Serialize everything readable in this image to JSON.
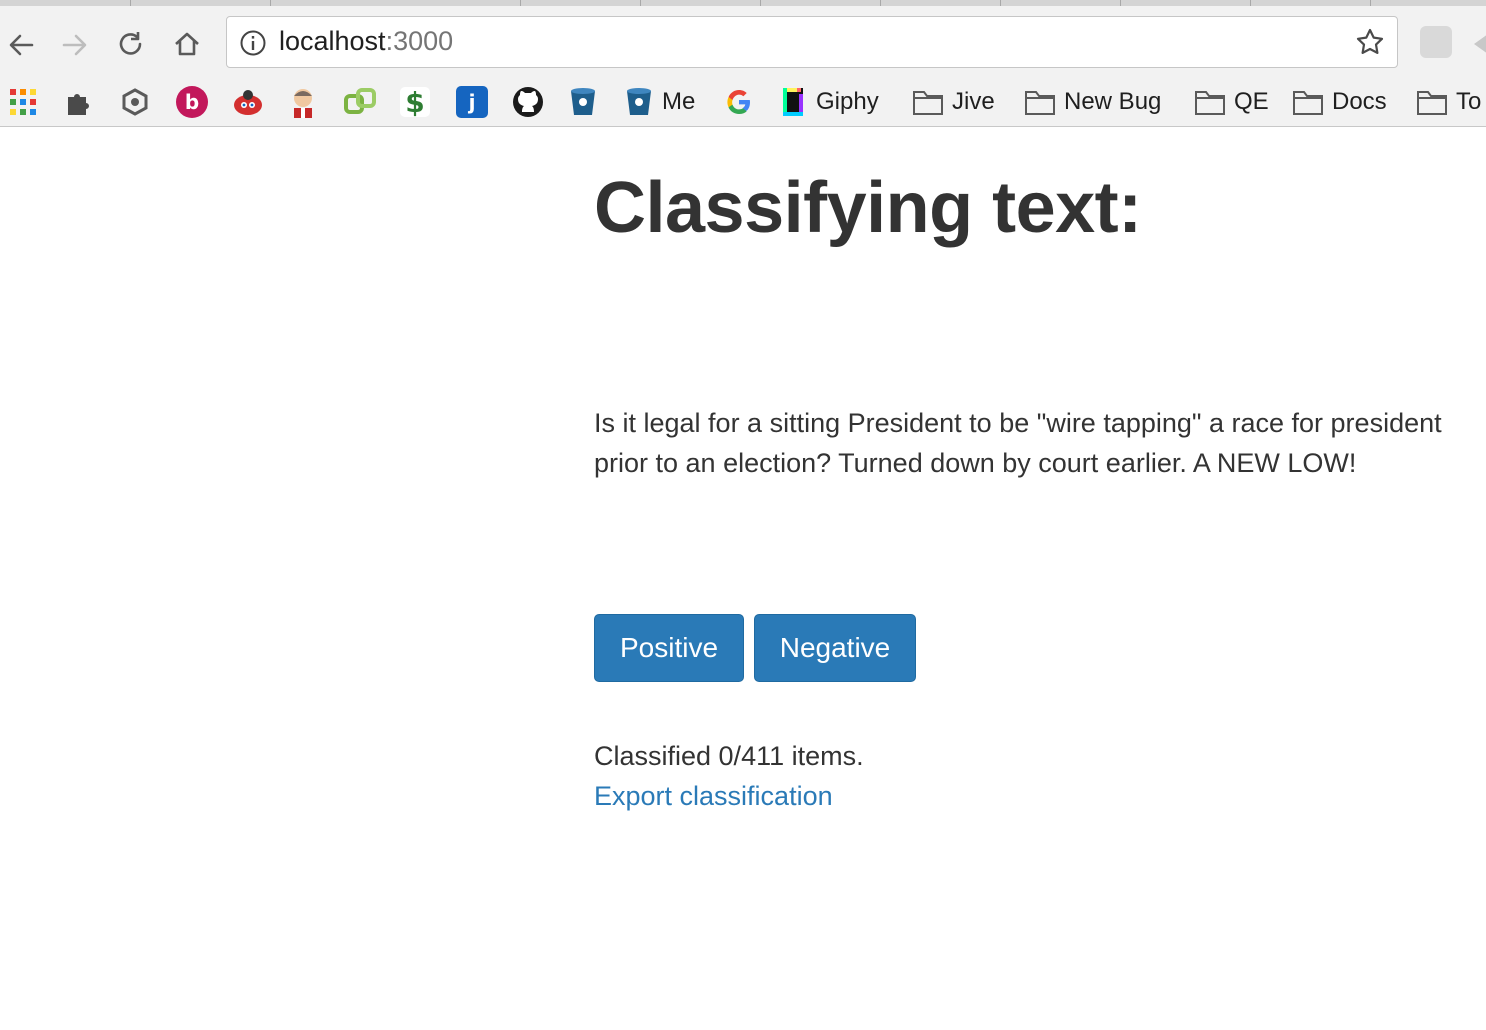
{
  "browser": {
    "url_host": "localhost",
    "url_port": ":3000",
    "bookmarks": [
      {
        "label": "",
        "icon": "apps-grid-icon"
      },
      {
        "label": "",
        "icon": "puzzle-icon"
      },
      {
        "label": "",
        "icon": "chrome-ext-icon"
      },
      {
        "label": "b",
        "icon": "b-badge-icon",
        "color": "#c2185b"
      },
      {
        "label": "",
        "icon": "ladybug-icon",
        "color": "#d32f2f"
      },
      {
        "label": "",
        "icon": "jenkins-icon"
      },
      {
        "label": "",
        "icon": "link-icon",
        "color": "#7cb342"
      },
      {
        "label": "$",
        "icon": "dollar-icon",
        "color": "#2e7d32"
      },
      {
        "label": "j",
        "icon": "j-badge-icon",
        "color": "#1565c0"
      },
      {
        "label": "",
        "icon": "github-icon"
      },
      {
        "label": "",
        "icon": "bucket-icon",
        "color": "#1e5e8c"
      },
      {
        "label": "Me",
        "icon": "bucket-icon",
        "color": "#1e5e8c"
      },
      {
        "label": "",
        "icon": "google-icon"
      },
      {
        "label": "Giphy",
        "icon": "giphy-icon"
      },
      {
        "label": "Jive",
        "icon": "folder-icon"
      },
      {
        "label": "New Bug",
        "icon": "folder-icon"
      },
      {
        "label": "QE",
        "icon": "folder-icon"
      },
      {
        "label": "Docs",
        "icon": "folder-icon"
      },
      {
        "label": "To",
        "icon": "folder-icon"
      }
    ]
  },
  "page": {
    "title": "Classifying text:",
    "text": "Is it legal for a sitting President to be \"wire tapping\" a race for president prior to an election? Turned down by court earlier. A NEW LOW!",
    "positive_label": "Positive",
    "negative_label": "Negative",
    "status": "Classified 0/411 items.",
    "export_label": "Export classification",
    "accent_color": "#2a7ab7"
  }
}
